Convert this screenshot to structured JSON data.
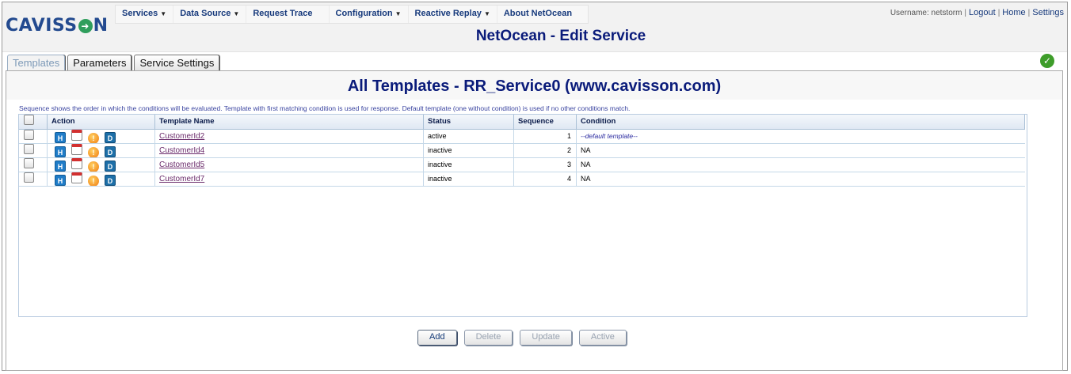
{
  "brand": {
    "logo_left": "CAVISS",
    "logo_mark": "O",
    "logo_right": "N"
  },
  "menu": [
    {
      "label": "Services",
      "dropdown": true
    },
    {
      "label": "Data Source",
      "dropdown": true
    },
    {
      "label": "Request Trace",
      "dropdown": false
    },
    {
      "label": "Configuration",
      "dropdown": true
    },
    {
      "label": "Reactive Replay",
      "dropdown": true
    },
    {
      "label": "About NetOcean",
      "dropdown": false
    }
  ],
  "user": {
    "label": "Username: netstorm",
    "logout": "Logout",
    "home": "Home",
    "settings": "Settings"
  },
  "app_title": "NetOcean - Edit Service",
  "tabs": [
    {
      "label": "Templates",
      "active": true
    },
    {
      "label": "Parameters",
      "active": false
    },
    {
      "label": "Service Settings",
      "active": false
    }
  ],
  "status_icon": "check-circle-icon",
  "section_title": "All Templates - RR_Service0 (www.cavisson.com)",
  "info_text": "Sequence shows the order in which the conditions will be evaluated. Template with first matching condition is used for response. Default template (one without condition) is used if no other conditions match.",
  "columns": {
    "action": "Action",
    "name": "Template Name",
    "status": "Status",
    "sequence": "Sequence",
    "condition": "Condition"
  },
  "action_icons": {
    "h": "H",
    "d": "D"
  },
  "rows": [
    {
      "name": "CustomerId2",
      "status": "active",
      "sequence": "1",
      "condition": "--default template--",
      "is_default": true
    },
    {
      "name": "CustomerId4",
      "status": "inactive",
      "sequence": "2",
      "condition": "NA",
      "is_default": false
    },
    {
      "name": "CustomerId5",
      "status": "inactive",
      "sequence": "3",
      "condition": "NA",
      "is_default": false
    },
    {
      "name": "CustomerId7",
      "status": "inactive",
      "sequence": "4",
      "condition": "NA",
      "is_default": false
    }
  ],
  "buttons": {
    "add": "Add",
    "delete": "Delete",
    "update": "Update",
    "active": "Active"
  },
  "colors": {
    "title_navy": "#0a1b7a",
    "link": "#6a2a6a",
    "ok_green": "#3e9d2a"
  }
}
